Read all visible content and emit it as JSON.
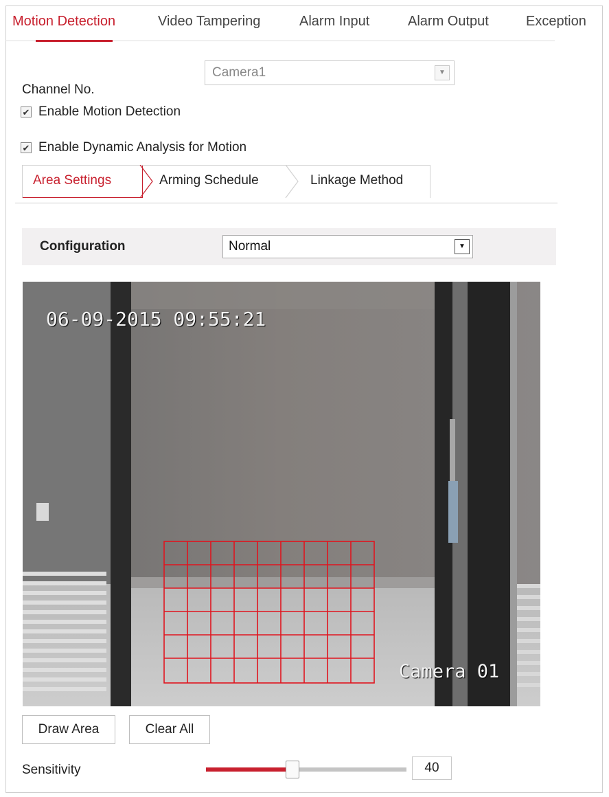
{
  "tabs": [
    {
      "label": "Motion Detection",
      "active": true
    },
    {
      "label": "Video Tampering",
      "active": false
    },
    {
      "label": "Alarm Input",
      "active": false
    },
    {
      "label": "Alarm Output",
      "active": false
    },
    {
      "label": "Exception",
      "active": false
    }
  ],
  "channel": {
    "label": "Channel No.",
    "value": "Camera1"
  },
  "options": {
    "enable_motion": {
      "label": "Enable Motion Detection",
      "checked": true
    },
    "enable_dynamic": {
      "label": "Enable Dynamic Analysis for Motion",
      "checked": true
    }
  },
  "sub_tabs": [
    {
      "label": "Area Settings",
      "active": true
    },
    {
      "label": "Arming Schedule",
      "active": false
    },
    {
      "label": "Linkage Method",
      "active": false
    }
  ],
  "configuration": {
    "label": "Configuration",
    "value": "Normal"
  },
  "video": {
    "timestamp": "06-09-2015 09:55:21",
    "camera_name": "Camera 01"
  },
  "buttons": {
    "draw_area": "Draw Area",
    "clear_all": "Clear All"
  },
  "sensitivity": {
    "label": "Sensitivity",
    "value": "40",
    "level": 0.43
  },
  "colors": {
    "accent": "#c8202e",
    "grid": "#e0141e"
  },
  "icons": {
    "dropdown": "chevron-down-icon",
    "check": "checkmark-icon"
  }
}
